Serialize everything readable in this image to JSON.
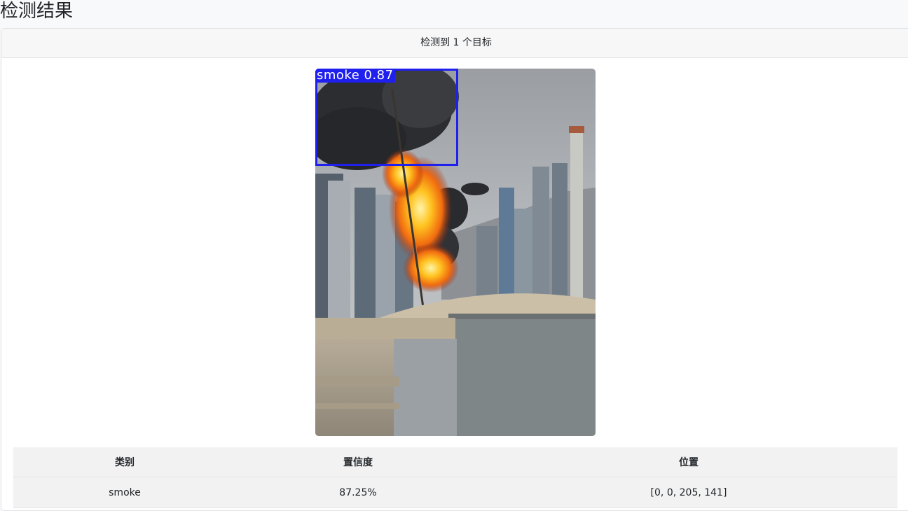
{
  "page": {
    "title": "检测结果"
  },
  "card": {
    "header": "检测到 1 个目标"
  },
  "detection_image": {
    "box_label": "smoke 0.87",
    "box_color": "#1f1fee"
  },
  "table": {
    "headers": [
      "类别",
      "置信度",
      "位置"
    ],
    "rows": [
      {
        "class": "smoke",
        "confidence": "87.25%",
        "position": "[0, 0, 205, 141]"
      }
    ]
  }
}
